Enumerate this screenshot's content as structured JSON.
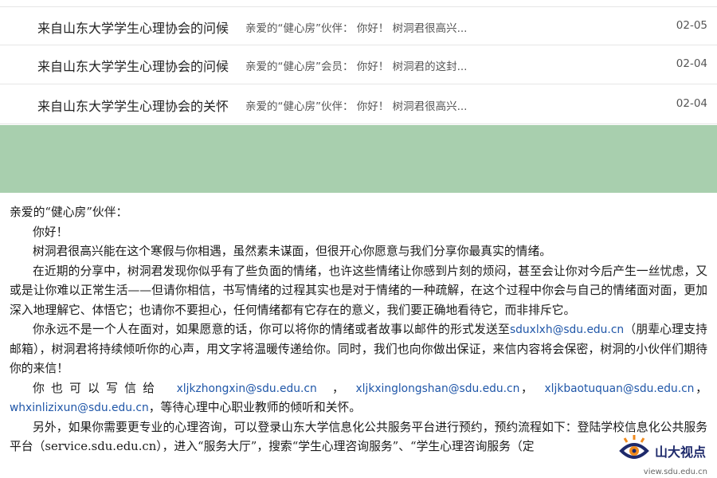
{
  "mail_list": [
    {
      "subject": "来自山东大学学生心理协会的问候",
      "preview": "亲爱的“健心房”伙伴：  你好！  树洞君很高兴...",
      "date": "02-05"
    },
    {
      "subject": "来自山东大学学生心理协会的问候",
      "preview": "亲爱的“健心房”会员：  你好！  树洞君的这封...",
      "date": "02-04"
    },
    {
      "subject": "来自山东大学学生心理协会的关怀",
      "preview": "亲爱的“健心房”伙伴：  你好！  树洞君很高兴...",
      "date": "02-04"
    }
  ],
  "letter": {
    "salutation": "亲爱的“健心房”伙伴：",
    "greeting": "你好！",
    "para1": "树洞君很高兴能在这个寒假与你相遇，虽然素未谋面，但很开心你愿意与我们分享你最真实的情绪。",
    "para2": "在近期的分享中，树洞君发现你似乎有了些负面的情绪，也许这些情绪让你感到片刻的烦闷，甚至会让你对今后产生一丝忧虑，又或是让你难以正常生活——但请你相信，书写情绪的过程其实也是对于情绪的一种疏解，在这个过程中你会与自己的情绪面对面，更加深入地理解它、体悟它；也请你不要担心，任何情绪都有它存在的意义，我们要正确地看待它，而非排斥它。",
    "para3_a": "你永远不是一个人在面对，如果愿意的话，你可以将你的情绪或者故事以邮件的形式发送至",
    "para3_email": "sduxlxh@sdu.edu.cn",
    "para3_b": "（朋辈心理支持邮箱），树洞君将持续倾听你的心声，用文字将温暖传递给你。同时，我们也向你做出保证，来信内容将会保密，树洞的小伙伴们期待你的来信！",
    "para4_a": "你也可以写信给",
    "emails": [
      "xljkzhongxin@sdu.edu.cn",
      "xljkxinglongshan@sdu.edu.cn",
      "xljkbaotuquan@sdu.edu.cn",
      "whxinlizixun@sdu.edu.cn"
    ],
    "para4_b": "，等待心理中心职业教师的倾听和关怀。",
    "para5": "另外，如果你需要更专业的心理咨询，可以登录山东大学信息化公共服务平台进行预约，预约流程如下：登陆学校信息化公共服务平台（service.sdu.edu.cn），进入“服务大厅”，搜索“学生心理咨询服务”、“学生心理咨询服务（定"
  },
  "watermark": {
    "logo_text": "山大视点",
    "url": "view.sdu.edu.cn"
  }
}
